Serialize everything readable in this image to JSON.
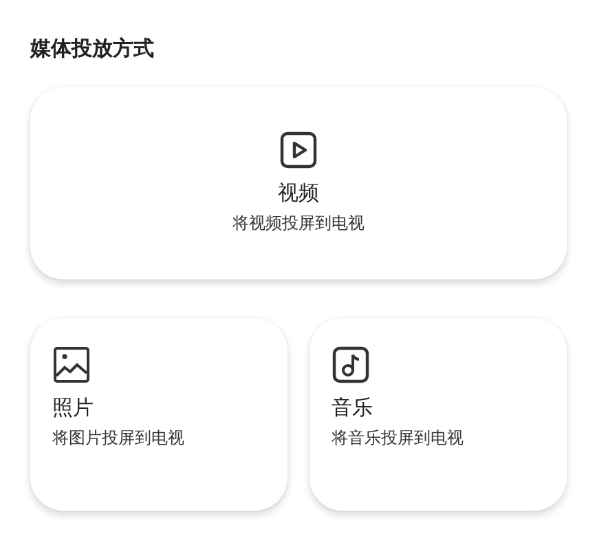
{
  "section_title": "媒体投放方式",
  "featured": {
    "kind": "video",
    "title": "视频",
    "subtitle": "将视频投屏到电视"
  },
  "cards": [
    {
      "kind": "photo",
      "title": "照片",
      "subtitle": "将图片投屏到电视"
    },
    {
      "kind": "music",
      "title": "音乐",
      "subtitle": "将音乐投屏到电视"
    }
  ]
}
